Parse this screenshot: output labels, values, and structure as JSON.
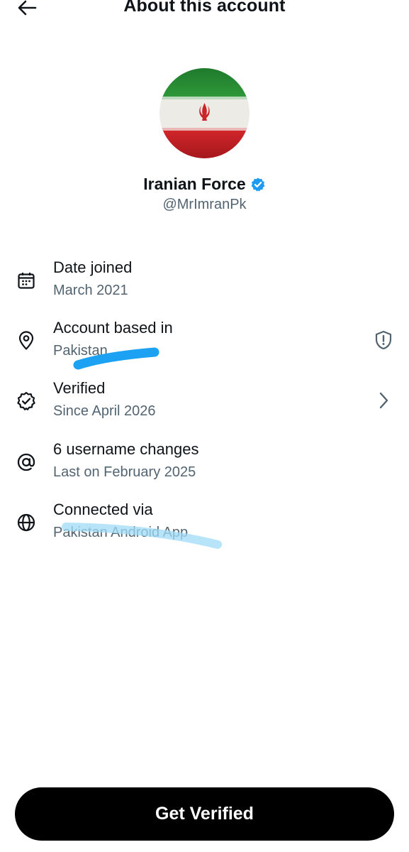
{
  "header": {
    "title": "About this account",
    "back_icon": "arrow-left-icon"
  },
  "profile": {
    "name": "Iranian Force",
    "handle": "@MrImranPk",
    "verified_badge_color": "#1d9bf0",
    "avatar": "iran-flag-avatar"
  },
  "details": [
    {
      "icon": "calendar-icon",
      "label": "Date joined",
      "value": "March 2021"
    },
    {
      "icon": "location-pin-icon",
      "label": "Account based in",
      "value": "Pakistan",
      "trailing_icon": "shield-alert-icon"
    },
    {
      "icon": "verified-badge-icon",
      "label": "Verified",
      "value": "Since April 2026",
      "trailing_icon": "chevron-right-icon"
    },
    {
      "icon": "at-sign-icon",
      "label": "6 username changes",
      "value": "Last on February 2025"
    },
    {
      "icon": "globe-icon",
      "label": "Connected via",
      "value": "Pakistan Android App"
    }
  ],
  "cta": {
    "label": "Get Verified"
  },
  "colors": {
    "text_primary": "#0f1419",
    "text_secondary": "#536471",
    "highlight_dark": "#1da1f2",
    "highlight_light": "#9fdcf7"
  }
}
